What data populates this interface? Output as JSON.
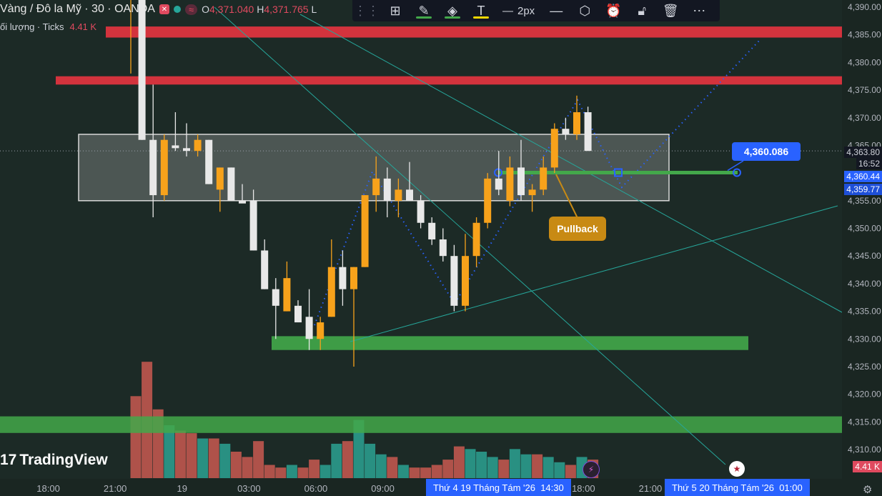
{
  "header": {
    "symbol_title": "Vàng / Đô la Mỹ · 30 · OANDA",
    "open_label": "O",
    "open_value": "4,371.040",
    "high_label": "H",
    "high_value": "4,371.765",
    "low_label": "L"
  },
  "volume_indicator": {
    "label": "ối lượng · Ticks",
    "value": "4.41 K"
  },
  "toolbar": {
    "line_width_label": "2px"
  },
  "chart_data": {
    "type": "candlestick",
    "ylim": [
      4306,
      4392
    ],
    "price_ticks": [
      4390,
      4385,
      4380,
      4375,
      4370,
      4365,
      4355,
      4350,
      4345,
      4340,
      4335,
      4330,
      4325,
      4320,
      4315,
      4310
    ],
    "price_tick_labels": [
      "4,390.00",
      "4,385.00",
      "4,380.00",
      "4,375.00",
      "4,370.00",
      "4,365.00",
      "4,355.00",
      "4,350.00",
      "4,345.00",
      "4,340.00",
      "4,335.00",
      "4,330.00",
      "4,325.00",
      "4,320.00",
      "4,315.00",
      "4,310.00"
    ],
    "time_axis": [
      {
        "label": "18:00",
        "i": -7.4
      },
      {
        "label": "21:00",
        "i": -1.4
      },
      {
        "label": "19",
        "i": 4.6
      },
      {
        "label": "03:00",
        "i": 10.6
      },
      {
        "label": "06:00",
        "i": 16.6
      },
      {
        "label": "09:00",
        "i": 22.6
      },
      {
        "label": "18:00",
        "i": 40.6
      },
      {
        "label": "21:00",
        "i": 46.6
      },
      {
        "label": "01:00",
        "i": 54.6
      }
    ],
    "candles": [
      {
        "o": 4394,
        "h": 4396,
        "l": 4378,
        "c": 4394,
        "dir": "up"
      },
      {
        "o": 4394,
        "h": 4396,
        "l": 4366,
        "c": 4366,
        "dir": "down"
      },
      {
        "o": 4366,
        "h": 4376,
        "l": 4352,
        "c": 4356,
        "dir": "down"
      },
      {
        "o": 4356,
        "h": 4367,
        "l": 4355,
        "c": 4366,
        "dir": "up"
      },
      {
        "o": 4365,
        "h": 4371,
        "l": 4364,
        "c": 4364.5,
        "dir": "down"
      },
      {
        "o": 4364.5,
        "h": 4369,
        "l": 4363,
        "c": 4364,
        "dir": "down"
      },
      {
        "o": 4364,
        "h": 4367,
        "l": 4363,
        "c": 4366,
        "dir": "up"
      },
      {
        "o": 4366,
        "h": 4366,
        "l": 4358,
        "c": 4358,
        "dir": "down"
      },
      {
        "o": 4357,
        "h": 4361,
        "l": 4353,
        "c": 4361,
        "dir": "up"
      },
      {
        "o": 4361,
        "h": 4361,
        "l": 4355,
        "c": 4355,
        "dir": "down"
      },
      {
        "o": 4355,
        "h": 4358,
        "l": 4355,
        "c": 4354.5,
        "dir": "down"
      },
      {
        "o": 4355,
        "h": 4357,
        "l": 4346,
        "c": 4346,
        "dir": "down"
      },
      {
        "o": 4346,
        "h": 4348,
        "l": 4339,
        "c": 4339,
        "dir": "down"
      },
      {
        "o": 4339,
        "h": 4341,
        "l": 4330,
        "c": 4336,
        "dir": "down"
      },
      {
        "o": 4335,
        "h": 4344,
        "l": 4335,
        "c": 4341,
        "dir": "up"
      },
      {
        "o": 4336,
        "h": 4337,
        "l": 4333,
        "c": 4333,
        "dir": "down"
      },
      {
        "o": 4334,
        "h": 4339,
        "l": 4328,
        "c": 4330,
        "dir": "down"
      },
      {
        "o": 4330,
        "h": 4334,
        "l": 4328,
        "c": 4333,
        "dir": "up"
      },
      {
        "o": 4334,
        "h": 4348,
        "l": 4334,
        "c": 4343,
        "dir": "up"
      },
      {
        "o": 4343,
        "h": 4346,
        "l": 4336,
        "c": 4339,
        "dir": "down"
      },
      {
        "o": 4339,
        "h": 4343,
        "l": 4325,
        "c": 4343,
        "dir": "up"
      },
      {
        "o": 4343,
        "h": 4356,
        "l": 4343,
        "c": 4356,
        "dir": "up"
      },
      {
        "o": 4356,
        "h": 4363,
        "l": 4353,
        "c": 4359,
        "dir": "up"
      },
      {
        "o": 4359,
        "h": 4361,
        "l": 4352,
        "c": 4355,
        "dir": "down"
      },
      {
        "o": 4355,
        "h": 4359,
        "l": 4352,
        "c": 4357,
        "dir": "up"
      },
      {
        "o": 4357,
        "h": 4362,
        "l": 4355,
        "c": 4355,
        "dir": "down"
      },
      {
        "o": 4355,
        "h": 4356,
        "l": 4350,
        "c": 4351,
        "dir": "down"
      },
      {
        "o": 4351,
        "h": 4352,
        "l": 4347,
        "c": 4348,
        "dir": "down"
      },
      {
        "o": 4348,
        "h": 4350,
        "l": 4344,
        "c": 4345,
        "dir": "down"
      },
      {
        "o": 4345,
        "h": 4347,
        "l": 4335,
        "c": 4336,
        "dir": "down"
      },
      {
        "o": 4336,
        "h": 4349,
        "l": 4335,
        "c": 4345,
        "dir": "up"
      },
      {
        "o": 4345,
        "h": 4352,
        "l": 4343,
        "c": 4351,
        "dir": "up"
      },
      {
        "o": 4351,
        "h": 4360,
        "l": 4350,
        "c": 4359,
        "dir": "up"
      },
      {
        "o": 4359,
        "h": 4364,
        "l": 4356,
        "c": 4357,
        "dir": "down"
      },
      {
        "o": 4355,
        "h": 4363,
        "l": 4354,
        "c": 4361,
        "dir": "up"
      },
      {
        "o": 4361,
        "h": 4366,
        "l": 4355,
        "c": 4356,
        "dir": "down"
      },
      {
        "o": 4356,
        "h": 4358,
        "l": 4353,
        "c": 4357,
        "dir": "up"
      },
      {
        "o": 4357,
        "h": 4363,
        "l": 4356,
        "c": 4361,
        "dir": "up"
      },
      {
        "o": 4361,
        "h": 4369,
        "l": 4360,
        "c": 4368,
        "dir": "up"
      },
      {
        "o": 4368,
        "h": 4370,
        "l": 4366,
        "c": 4367,
        "dir": "down"
      },
      {
        "o": 4367,
        "h": 4374,
        "l": 4366,
        "c": 4371,
        "dir": "up"
      },
      {
        "o": 4371,
        "h": 4372,
        "l": 4364,
        "c": 4364,
        "dir": "down"
      }
    ],
    "volumes": [
      {
        "v": 3.1,
        "c": "red"
      },
      {
        "v": 4.4,
        "c": "red"
      },
      {
        "v": 2.6,
        "c": "red"
      },
      {
        "v": 2.0,
        "c": "teal"
      },
      {
        "v": 1.8,
        "c": "red"
      },
      {
        "v": 1.7,
        "c": "red"
      },
      {
        "v": 1.5,
        "c": "teal"
      },
      {
        "v": 1.5,
        "c": "red"
      },
      {
        "v": 1.3,
        "c": "teal"
      },
      {
        "v": 1.0,
        "c": "red"
      },
      {
        "v": 0.8,
        "c": "red"
      },
      {
        "v": 1.4,
        "c": "red"
      },
      {
        "v": 0.5,
        "c": "red"
      },
      {
        "v": 0.4,
        "c": "red"
      },
      {
        "v": 0.5,
        "c": "teal"
      },
      {
        "v": 0.4,
        "c": "red"
      },
      {
        "v": 0.7,
        "c": "red"
      },
      {
        "v": 0.5,
        "c": "teal"
      },
      {
        "v": 1.3,
        "c": "teal"
      },
      {
        "v": 1.4,
        "c": "red"
      },
      {
        "v": 2.2,
        "c": "teal"
      },
      {
        "v": 1.3,
        "c": "teal"
      },
      {
        "v": 0.9,
        "c": "teal"
      },
      {
        "v": 0.8,
        "c": "red"
      },
      {
        "v": 0.5,
        "c": "teal"
      },
      {
        "v": 0.4,
        "c": "red"
      },
      {
        "v": 0.4,
        "c": "red"
      },
      {
        "v": 0.5,
        "c": "red"
      },
      {
        "v": 0.7,
        "c": "red"
      },
      {
        "v": 1.2,
        "c": "red"
      },
      {
        "v": 1.1,
        "c": "teal"
      },
      {
        "v": 1.0,
        "c": "teal"
      },
      {
        "v": 0.8,
        "c": "teal"
      },
      {
        "v": 0.7,
        "c": "red"
      },
      {
        "v": 1.1,
        "c": "teal"
      },
      {
        "v": 0.9,
        "c": "teal"
      },
      {
        "v": 0.9,
        "c": "red"
      },
      {
        "v": 0.8,
        "c": "teal"
      },
      {
        "v": 0.6,
        "c": "teal"
      },
      {
        "v": 0.5,
        "c": "red"
      },
      {
        "v": 0.8,
        "c": "teal"
      },
      {
        "v": 0.7,
        "c": "red"
      }
    ],
    "zones": {
      "resistance_upper": [
        4384.5,
        4386.5
      ],
      "resistance_lower": [
        4376,
        4377.5
      ],
      "range_box": [
        4355,
        4367
      ],
      "support_lower": [
        4328,
        4330.5
      ],
      "support_bottom": [
        4313,
        4316
      ],
      "pullback_level": 4360.086
    },
    "annotations": {
      "pullback_text": "Pullback",
      "target_price": "4,360.086"
    }
  },
  "price_tags": {
    "current_price": "4,363.80",
    "countdown": "16:52",
    "level_a": "4,360.44",
    "level_b": "4,359.77",
    "volume_tag": "4.41 K"
  },
  "branding": {
    "logo_text": "TradingView"
  },
  "time_highlight": {
    "crosshair_date": "Thứ 4 19 Tháng Tám '26",
    "crosshair_time": "14:30",
    "end_date": "Thứ 5 20 Tháng Tám '26",
    "end_time": "01:00"
  },
  "colors": {
    "background": "#1c2a26",
    "bull": "#f7a21b",
    "bear": "#e8e8e8",
    "vol_red": "#c0574f",
    "vol_teal": "#2b9b8d",
    "red_zone": "#d3333d",
    "green_zone": "#43a84a",
    "blue": "#2962ff"
  }
}
